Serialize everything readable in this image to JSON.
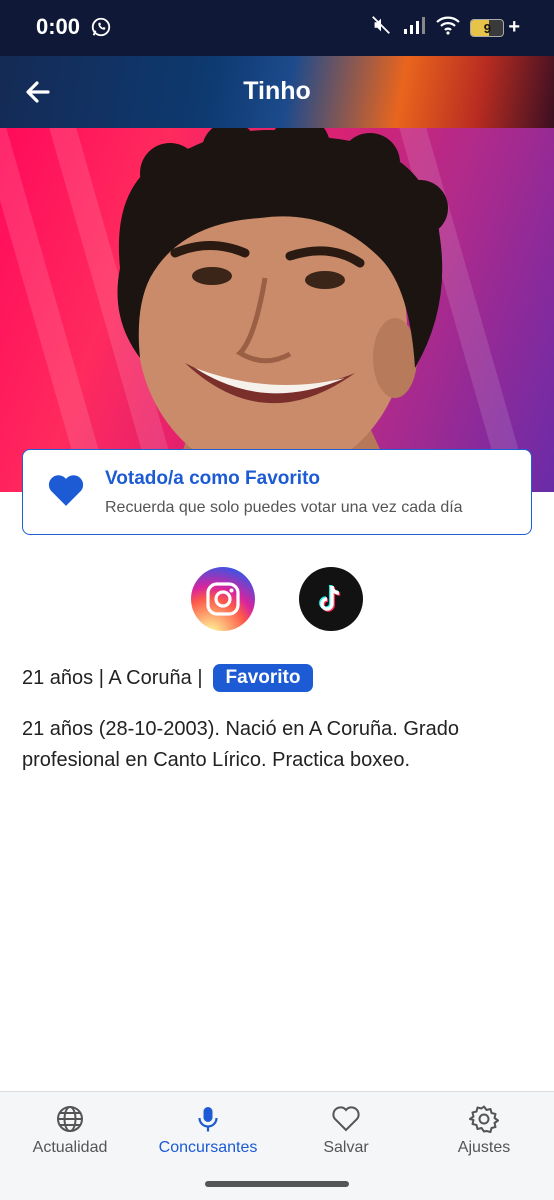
{
  "status_bar": {
    "time": "0:00",
    "battery": "9"
  },
  "header": {
    "title": "Tinho"
  },
  "vote_card": {
    "title": "Votado/a como Favorito",
    "subtitle": "Recuerda que solo puedes votar una vez cada día"
  },
  "profile": {
    "meta_text": "21 años | A Coruña |",
    "badge": "Favorito",
    "bio": "21 años (28-10-2003). Nació en A Coruña. Grado profesional en Canto Lírico. Practica boxeo."
  },
  "bottom_nav": {
    "items": [
      {
        "label": "Actualidad",
        "icon": "globe-icon"
      },
      {
        "label": "Concursantes",
        "icon": "microphone-icon",
        "active": true
      },
      {
        "label": "Salvar",
        "icon": "heart-outline-icon"
      },
      {
        "label": "Ajustes",
        "icon": "gear-icon"
      }
    ]
  },
  "colors": {
    "accent": "#1c5bd3",
    "status_bar": "#0f1836"
  }
}
